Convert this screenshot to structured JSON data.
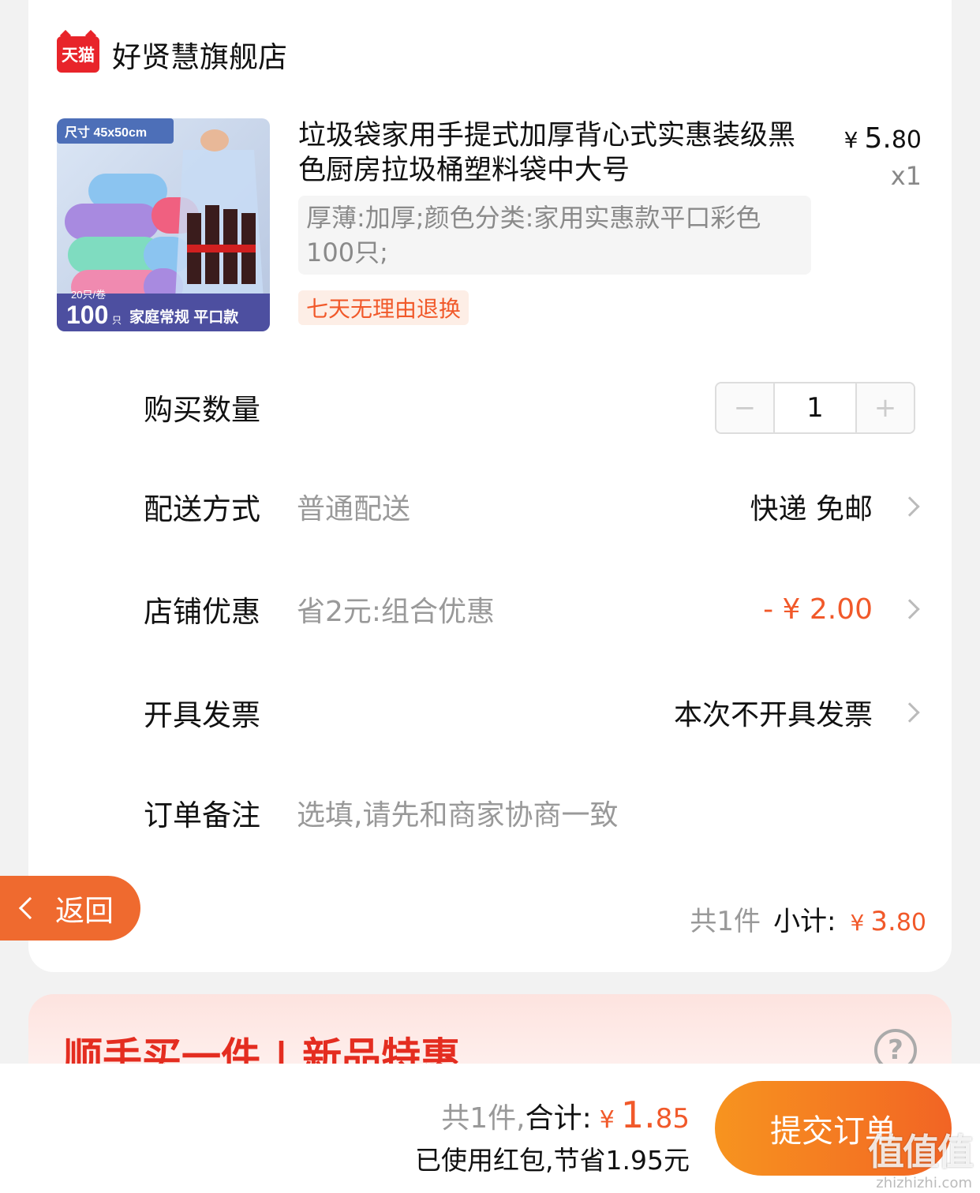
{
  "store": {
    "logo_text": "天猫",
    "name": "好贤慧旗舰店"
  },
  "product": {
    "image_text": {
      "size_tag": "尺寸 45x50cm",
      "per_roll": "20只/卷",
      "count": "100",
      "count_unit": "只",
      "caption": "家庭常规 平口款"
    },
    "title": "垃圾袋家用手提式加厚背心式实惠装级黑色厨房拉圾桶塑料袋中大号",
    "price_symbol": "¥",
    "price_int": "5.",
    "price_dec": "80",
    "quantity_label": "x1",
    "sku": "厚薄:加厚;颜色分类:家用实惠款平口彩色100只;",
    "return_badge": "七天无理由退换"
  },
  "rows": {
    "quantity": {
      "label": "购买数量",
      "value": "1",
      "minus": "−",
      "plus": "+"
    },
    "delivery": {
      "label": "配送方式",
      "sub": "普通配送",
      "value": "快递 免邮"
    },
    "discount": {
      "label": "店铺优惠",
      "sub": "省2元:组合优惠",
      "value": "- ¥ 2.00"
    },
    "invoice": {
      "label": "开具发票",
      "value": "本次不开具发票"
    },
    "remark": {
      "label": "订单备注",
      "placeholder": "选填,请先和商家协商一致"
    }
  },
  "subtotal": {
    "count": "共1件",
    "label": "小计:",
    "symbol": "¥",
    "int": "3.",
    "dec": "80"
  },
  "back_button": {
    "label": "返回"
  },
  "promo": {
    "title": "顺手买一件 | 新品特惠",
    "help": "?"
  },
  "footer": {
    "count": "共1件,",
    "label": "合计:",
    "symbol": "¥",
    "int": "1.",
    "dec": "85",
    "saving": "已使用红包,节省1.95元",
    "submit": "提交订单"
  },
  "watermark": {
    "text": "值值值",
    "url": "zhizhizhi.com"
  },
  "colors": {
    "accent": "#f1592a",
    "tmall_red": "#e8242a",
    "promo_red": "#e42d20"
  }
}
